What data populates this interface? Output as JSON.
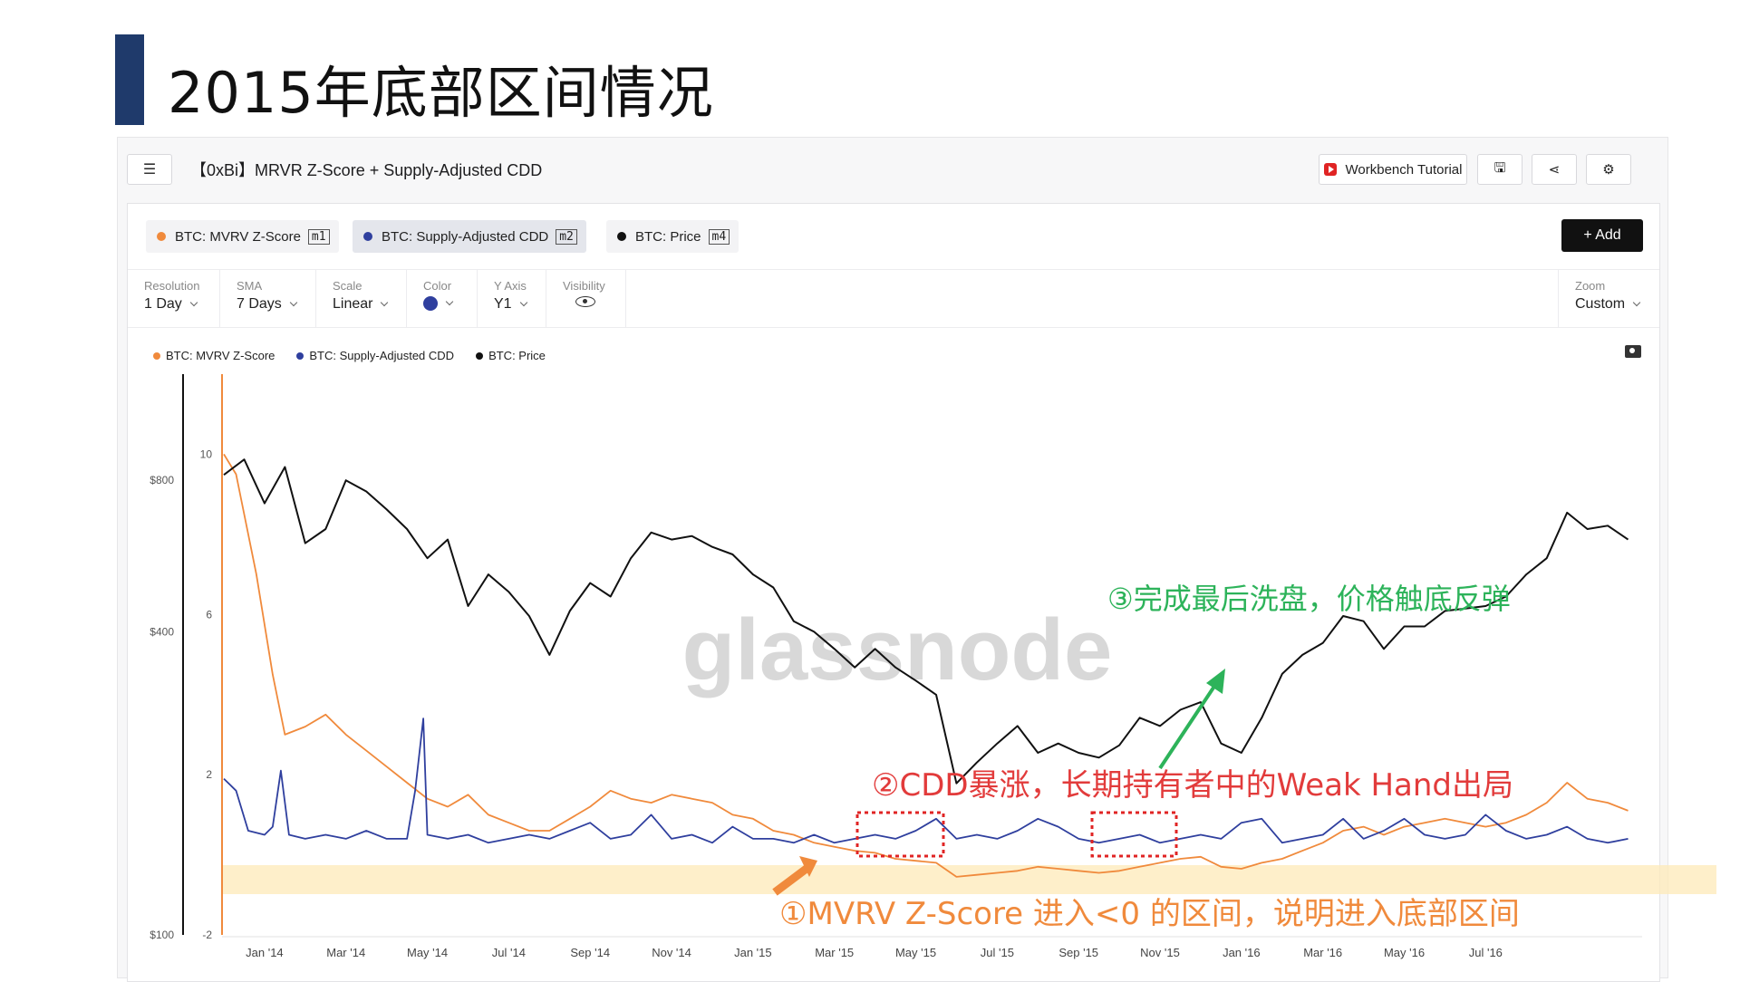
{
  "page": {
    "title": "2015年底部区间情况"
  },
  "header": {
    "chart_name": "【0xBi】MRVR Z-Score + Supply-Adjusted CDD",
    "tutorial_label": "Workbench Tutorial"
  },
  "metrics": [
    {
      "label": "BTC: MVRV Z-Score",
      "tag": "m1",
      "color": "#f08a3c"
    },
    {
      "label": "BTC: Supply-Adjusted CDD",
      "tag": "m2",
      "color": "#2f3f9e"
    },
    {
      "label": "BTC: Price",
      "tag": "m4",
      "color": "#111111"
    }
  ],
  "add_label": "+ Add",
  "settings": {
    "resolution": {
      "label": "Resolution",
      "value": "1 Day"
    },
    "sma": {
      "label": "SMA",
      "value": "7 Days"
    },
    "scale": {
      "label": "Scale",
      "value": "Linear"
    },
    "color": {
      "label": "Color"
    },
    "yaxis": {
      "label": "Y Axis",
      "value": "Y1"
    },
    "visibility": {
      "label": "Visibility"
    },
    "zoom": {
      "label": "Zoom",
      "value": "Custom"
    }
  },
  "chart_data": {
    "type": "line",
    "watermark": "glassnode",
    "x_ticks": [
      "Jan '14",
      "Mar '14",
      "May '14",
      "Jul '14",
      "Sep '14",
      "Nov '14",
      "Jan '15",
      "Mar '15",
      "May '15",
      "Jul '15",
      "Sep '15",
      "Nov '15",
      "Jan '16",
      "Mar '16",
      "May '16",
      "Jul '16"
    ],
    "y1_ticks": [
      "10",
      "6",
      "2",
      "-2"
    ],
    "y2_ticks": [
      "$800",
      "$400",
      "$100"
    ],
    "y1_range": [
      -2,
      12
    ],
    "price_log_range": [
      100,
      1300
    ],
    "legend": [
      "BTC: MVRV Z-Score",
      "BTC: Supply-Adjusted CDD",
      "BTC: Price"
    ],
    "series": [
      {
        "name": "BTC: Price",
        "axis": "price",
        "color": "#111111",
        "points": [
          [
            0,
            820
          ],
          [
            0.5,
            880
          ],
          [
            1,
            720
          ],
          [
            1.5,
            850
          ],
          [
            2,
            600
          ],
          [
            2.5,
            640
          ],
          [
            3,
            800
          ],
          [
            3.5,
            760
          ],
          [
            4,
            700
          ],
          [
            4.5,
            640
          ],
          [
            5,
            560
          ],
          [
            5.5,
            610
          ],
          [
            6,
            450
          ],
          [
            6.5,
            520
          ],
          [
            7,
            480
          ],
          [
            7.5,
            430
          ],
          [
            8,
            360
          ],
          [
            8.5,
            440
          ],
          [
            9,
            500
          ],
          [
            9.5,
            470
          ],
          [
            10,
            560
          ],
          [
            10.5,
            630
          ],
          [
            11,
            610
          ],
          [
            11.5,
            620
          ],
          [
            12,
            590
          ],
          [
            12.5,
            570
          ],
          [
            13,
            520
          ],
          [
            13.5,
            490
          ],
          [
            14,
            420
          ],
          [
            14.5,
            400
          ],
          [
            15,
            370
          ],
          [
            15.5,
            340
          ],
          [
            16,
            370
          ],
          [
            16.5,
            340
          ],
          [
            17,
            320
          ],
          [
            17.5,
            300
          ],
          [
            18,
            200
          ],
          [
            18.5,
            220
          ],
          [
            19,
            240
          ],
          [
            19.5,
            260
          ],
          [
            20,
            230
          ],
          [
            20.5,
            240
          ],
          [
            21,
            230
          ],
          [
            21.5,
            225
          ],
          [
            22,
            238
          ],
          [
            22.5,
            270
          ],
          [
            23,
            260
          ],
          [
            23.5,
            280
          ],
          [
            24,
            290
          ],
          [
            24.5,
            240
          ],
          [
            25,
            230
          ],
          [
            25.5,
            270
          ],
          [
            26,
            330
          ],
          [
            26.5,
            360
          ],
          [
            27,
            380
          ],
          [
            27.5,
            430
          ],
          [
            28,
            420
          ],
          [
            28.5,
            370
          ],
          [
            29,
            410
          ],
          [
            29.5,
            410
          ],
          [
            30,
            440
          ],
          [
            30.5,
            445
          ],
          [
            31,
            450
          ],
          [
            31.5,
            470
          ],
          [
            32,
            520
          ],
          [
            32.5,
            560
          ],
          [
            33,
            690
          ],
          [
            33.5,
            640
          ],
          [
            34,
            650
          ],
          [
            34.5,
            610
          ]
        ],
        "x_unit": "months since Dec 2013"
      },
      {
        "name": "BTC: MVRV Z-Score",
        "axis": "y1",
        "color": "#f08a3c",
        "points": [
          [
            0,
            10
          ],
          [
            0.3,
            9.5
          ],
          [
            0.8,
            7
          ],
          [
            1.2,
            4.5
          ],
          [
            1.5,
            3
          ],
          [
            2,
            3.2
          ],
          [
            2.5,
            3.5
          ],
          [
            3,
            3
          ],
          [
            3.5,
            2.6
          ],
          [
            4,
            2.2
          ],
          [
            4.5,
            1.8
          ],
          [
            5,
            1.4
          ],
          [
            5.5,
            1.2
          ],
          [
            6,
            1.5
          ],
          [
            6.5,
            1.0
          ],
          [
            7,
            0.8
          ],
          [
            7.5,
            0.6
          ],
          [
            8,
            0.6
          ],
          [
            8.5,
            0.9
          ],
          [
            9,
            1.2
          ],
          [
            9.5,
            1.6
          ],
          [
            10,
            1.4
          ],
          [
            10.5,
            1.3
          ],
          [
            11,
            1.5
          ],
          [
            11.5,
            1.4
          ],
          [
            12,
            1.3
          ],
          [
            12.5,
            1.0
          ],
          [
            13,
            0.9
          ],
          [
            13.5,
            0.6
          ],
          [
            14,
            0.5
          ],
          [
            14.5,
            0.3
          ],
          [
            15,
            0.2
          ],
          [
            15.5,
            0.1
          ],
          [
            16,
            0.05
          ],
          [
            16.5,
            -0.1
          ],
          [
            17,
            -0.15
          ],
          [
            17.5,
            -0.2
          ],
          [
            18,
            -0.55
          ],
          [
            18.5,
            -0.5
          ],
          [
            19,
            -0.45
          ],
          [
            19.5,
            -0.4
          ],
          [
            20,
            -0.3
          ],
          [
            20.5,
            -0.35
          ],
          [
            21,
            -0.4
          ],
          [
            21.5,
            -0.45
          ],
          [
            22,
            -0.4
          ],
          [
            22.5,
            -0.3
          ],
          [
            23,
            -0.2
          ],
          [
            23.5,
            -0.1
          ],
          [
            24,
            -0.05
          ],
          [
            24.5,
            -0.3
          ],
          [
            25,
            -0.35
          ],
          [
            25.5,
            -0.2
          ],
          [
            26,
            -0.1
          ],
          [
            26.5,
            0.1
          ],
          [
            27,
            0.3
          ],
          [
            27.5,
            0.6
          ],
          [
            28,
            0.7
          ],
          [
            28.5,
            0.5
          ],
          [
            29,
            0.7
          ],
          [
            29.5,
            0.8
          ],
          [
            30,
            0.9
          ],
          [
            30.5,
            0.8
          ],
          [
            31,
            0.7
          ],
          [
            31.5,
            0.8
          ],
          [
            32,
            1.0
          ],
          [
            32.5,
            1.3
          ],
          [
            33,
            1.8
          ],
          [
            33.5,
            1.4
          ],
          [
            34,
            1.3
          ],
          [
            34.5,
            1.1
          ]
        ]
      },
      {
        "name": "BTC: Supply-Adjusted CDD",
        "axis": "y1",
        "color": "#2f3f9e",
        "points": [
          [
            0,
            1.9
          ],
          [
            0.3,
            1.6
          ],
          [
            0.6,
            0.6
          ],
          [
            1,
            0.5
          ],
          [
            1.2,
            0.7
          ],
          [
            1.4,
            2.1
          ],
          [
            1.6,
            0.5
          ],
          [
            2,
            0.4
          ],
          [
            2.5,
            0.5
          ],
          [
            3,
            0.4
          ],
          [
            3.5,
            0.6
          ],
          [
            4,
            0.4
          ],
          [
            4.5,
            0.4
          ],
          [
            4.7,
            1.6
          ],
          [
            4.9,
            3.4
          ],
          [
            5,
            0.5
          ],
          [
            5.5,
            0.4
          ],
          [
            6,
            0.5
          ],
          [
            6.5,
            0.3
          ],
          [
            7,
            0.4
          ],
          [
            7.5,
            0.5
          ],
          [
            8,
            0.4
          ],
          [
            8.5,
            0.6
          ],
          [
            9,
            0.8
          ],
          [
            9.5,
            0.4
          ],
          [
            10,
            0.5
          ],
          [
            10.5,
            1.0
          ],
          [
            11,
            0.4
          ],
          [
            11.5,
            0.5
          ],
          [
            12,
            0.3
          ],
          [
            12.5,
            0.7
          ],
          [
            13,
            0.4
          ],
          [
            13.5,
            0.4
          ],
          [
            14,
            0.3
          ],
          [
            14.5,
            0.5
          ],
          [
            15,
            0.3
          ],
          [
            15.5,
            0.4
          ],
          [
            16,
            0.5
          ],
          [
            16.5,
            0.4
          ],
          [
            17,
            0.6
          ],
          [
            17.5,
            0.9
          ],
          [
            18,
            0.4
          ],
          [
            18.5,
            0.5
          ],
          [
            19,
            0.4
          ],
          [
            19.5,
            0.6
          ],
          [
            20,
            0.9
          ],
          [
            20.5,
            0.7
          ],
          [
            21,
            0.4
          ],
          [
            21.5,
            0.3
          ],
          [
            22,
            0.4
          ],
          [
            22.5,
            0.5
          ],
          [
            23,
            0.3
          ],
          [
            23.5,
            0.4
          ],
          [
            24,
            0.5
          ],
          [
            24.5,
            0.4
          ],
          [
            25,
            0.8
          ],
          [
            25.5,
            0.9
          ],
          [
            26,
            0.3
          ],
          [
            26.5,
            0.4
          ],
          [
            27,
            0.5
          ],
          [
            27.5,
            0.9
          ],
          [
            28,
            0.4
          ],
          [
            28.5,
            0.6
          ],
          [
            29,
            0.9
          ],
          [
            29.5,
            0.5
          ],
          [
            30,
            0.4
          ],
          [
            30.5,
            0.5
          ],
          [
            31,
            1.0
          ],
          [
            31.5,
            0.6
          ],
          [
            32,
            0.4
          ],
          [
            32.5,
            0.5
          ],
          [
            33,
            0.7
          ],
          [
            33.5,
            0.4
          ],
          [
            34,
            0.3
          ],
          [
            34.5,
            0.4
          ]
        ]
      }
    ],
    "annotations": [
      {
        "text": "①MVRV Z-Score 进入<0 的区间，说明进入底部区间",
        "color": "#f08a3c"
      },
      {
        "text": "②CDD暴涨，长期持有者中的Weak Hand出局",
        "color": "#e23b3b"
      },
      {
        "text": "③完成最后洗盘，价格触底反弹",
        "color": "#2db35a"
      }
    ]
  }
}
